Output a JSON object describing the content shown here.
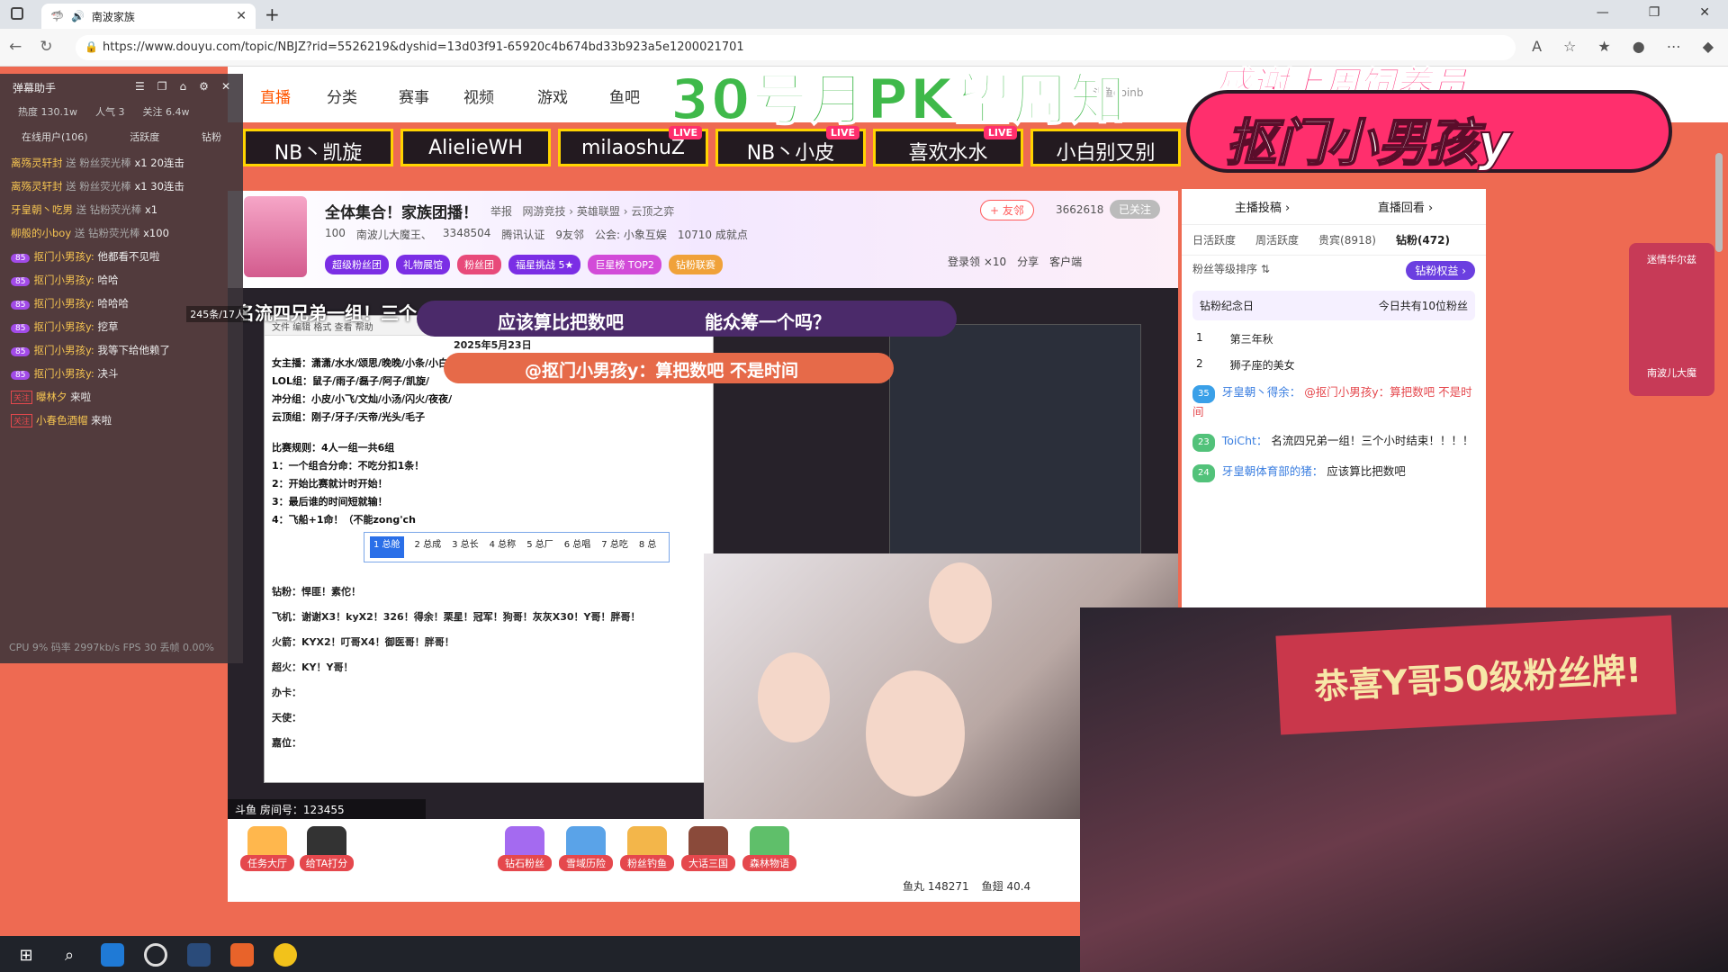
{
  "browser": {
    "tab_title": "南波家族",
    "url": "https://www.douyu.com/topic/NBJZ?rid=5526219&dyshid=13d03f91-65920c4b674bd33b923a5e1200021701",
    "new_tab": "+",
    "close": "✕",
    "window_controls": [
      "—",
      "❐",
      "✕"
    ]
  },
  "site_nav": {
    "items": [
      "直播",
      "分类",
      "赛事",
      "视频",
      "游戏",
      "鱼吧"
    ],
    "search_placeholder": "斗鱼doinb"
  },
  "overlay": {
    "banner": "30号月PK望周知",
    "thanks": "感谢上周饲养员",
    "big_name": "抠门小男孩y",
    "name_tabs": [
      {
        "name": "NB丶凯旋",
        "live": ""
      },
      {
        "name": "AlielieWH",
        "live": ""
      },
      {
        "name": "milaoshuZ",
        "live": "LIVE"
      },
      {
        "name": "NB丶小皮",
        "live": "LIVE"
      },
      {
        "name": "喜欢水水",
        "live": "LIVE"
      },
      {
        "name": "小白别又别",
        "live": ""
      }
    ]
  },
  "room": {
    "title": "全体集合！家族团播！",
    "report": "举报",
    "category": "网游竞技 › 英雄联盟 › 云顶之弈",
    "level": "100",
    "anchor": "南波儿大魔王、",
    "hot": "3348504",
    "verified": "腾讯认证",
    "friends": "9友邻",
    "guild": "公会: 小象互娱",
    "achievements": "10710 成就点",
    "badges": [
      "超级粉丝团",
      "礼物展馆",
      "粉丝团",
      "福星挑战 5★",
      "巨星榜 TOP2",
      "钻粉联赛"
    ],
    "follow": "+ 友邻",
    "fans_count": "3662618",
    "followed": "已关注",
    "tools": [
      "分享",
      "客户端"
    ],
    "login_reward": "登录领 ×10"
  },
  "video": {
    "danmu_top": "名流四兄弟一组！三个",
    "danmu1": [
      "应该算比把数吧",
      "能众筹一个吗？"
    ],
    "danmu2": "@抠门小男孩y：算把数吧 不是时间",
    "doc_header": "文件  编辑  格式  查看  帮助",
    "doc_date": "2025年5月23日",
    "doc_lines": [
      "女主播：潇潇/水水/颂思/晚晚/小条/小白",
      "LOL组：鼠子/雨子/磊子/阿子/凯旋/",
      "冲分组：小皮/小飞/文灿/小汤/闪火/夜夜/",
      "云顶组：刚子/牙子/天帝/光头/毛子"
    ],
    "doc_rules": [
      "比赛规则：4人一组一共6组",
      "1：一个组合分命：不吃分扣1条！",
      "2：开始比赛就计时开始！",
      "3：最后谁的时间短就输！",
      "4：飞船+1命！（不能zong'ch"
    ],
    "ime_candidates": [
      "1 总舱",
      "2 总成",
      "3 总长",
      "4 总称",
      "5 总厂",
      "6 总唱",
      "7 总吃",
      "8 总"
    ],
    "doc_rewards": [
      "钻粉：悍匪！素佗！",
      "飞机：谢谢X3！kyX2！326！得余！栗星！冠军！狗哥！灰灰X30！Y哥！胖哥！",
      "火箭：KYX2！叮哥X4！御医哥！胖哥！",
      "超火：KY！Y哥！",
      "办卡：",
      "天使：",
      "嘉位："
    ],
    "room_id": "斗鱼 房间号：123455"
  },
  "gifts": [
    {
      "label": "任务大厅"
    },
    {
      "label": "给TA打分"
    },
    {
      "label": "钻石粉丝"
    },
    {
      "label": "雪域历险"
    },
    {
      "label": "粉丝钓鱼"
    },
    {
      "label": "大话三国"
    },
    {
      "label": "森林物语"
    }
  ],
  "gift_stats": {
    "yuwan": "鱼丸 148271",
    "yuchi": "鱼翅 40.4"
  },
  "chat": {
    "tabs": [
      "主播投稿 ›",
      "直播回看 ›"
    ],
    "subtabs": [
      "日活跃度",
      "周活跃度",
      "贵宾(8918)",
      "钻粉(472)"
    ],
    "rank_label": "粉丝等级排序 ⇅",
    "rank_button": "钻粉权益 ›",
    "memorial": "钻粉纪念日",
    "memorial_note": "今日共有10位粉丝",
    "ranks": [
      {
        "no": "1",
        "name": "第三年秋"
      },
      {
        "no": "2",
        "name": "狮子座的美女"
      }
    ],
    "messages": [
      {
        "lvl": "35",
        "nick": "牙皇朝丶得余：",
        "text": "@抠门小男孩y：算把数吧 不是时间"
      },
      {
        "lvl": "23",
        "nick": "ToiCht：",
        "text": "名流四兄弟一组！三个小时结束！！！！"
      },
      {
        "lvl": "24",
        "nick": "牙皇朝体育部的猪：",
        "text": "应该算比把数吧"
      }
    ]
  },
  "helper": {
    "title": "弹幕助手",
    "stats": [
      "热度 130.1w",
      "人气 3",
      "关注 6.4w"
    ],
    "subtabs": [
      "在线用户(106)",
      "活跃度",
      "钻粉"
    ],
    "float_count": "245条/17人",
    "lines": [
      {
        "user": "离殇灵轩封",
        "text": "送 粉丝荧光棒",
        "count": "x1 20连击"
      },
      {
        "user": "离殇灵轩封",
        "text": "送 粉丝荧光棒",
        "count": "x1 30连击"
      },
      {
        "user": "牙皇朝丶吃男",
        "text": "送 钻粉荧光棒",
        "count": "x1"
      },
      {
        "user": "柳般的小boy",
        "text": "送 钻粉荧光棒",
        "count": "x100"
      }
    ],
    "chats": [
      {
        "user": "抠门小男孩y:",
        "text": "他都看不见啦"
      },
      {
        "user": "抠门小男孩y:",
        "text": "哈哈"
      },
      {
        "user": "抠门小男孩y:",
        "text": "哈哈哈"
      },
      {
        "user": "抠门小男孩y:",
        "text": "挖草"
      },
      {
        "user": "抠门小男孩y:",
        "text": "我等下给他赖了"
      },
      {
        "user": "抠门小男孩y:",
        "text": "决斗"
      }
    ],
    "joins": [
      {
        "user": "曝林夕",
        "text": "来啦"
      },
      {
        "user": "小春色酒帽",
        "text": "来啦"
      }
    ],
    "level": "85",
    "cpu": "CPU 9%  码率 2997kb/s  FPS 30  丢帧 0.00%"
  },
  "cam2": {
    "banner": "恭喜Y哥50级粉丝牌!"
  },
  "side_deco": {
    "title": "迷情华尔兹",
    "sub": "南波儿大魔"
  },
  "colors": {
    "accent": "#ff5500",
    "banner_green": "#3fb94a",
    "brand_pink": "#ff2f6d",
    "page_bg": "#ee6a52"
  },
  "taskbar": {
    "icons": [
      "windows-icon",
      "search-icon",
      "edge-icon",
      "obs-icon",
      "app-icon",
      "douyu-icon",
      "chrome-icon"
    ]
  }
}
